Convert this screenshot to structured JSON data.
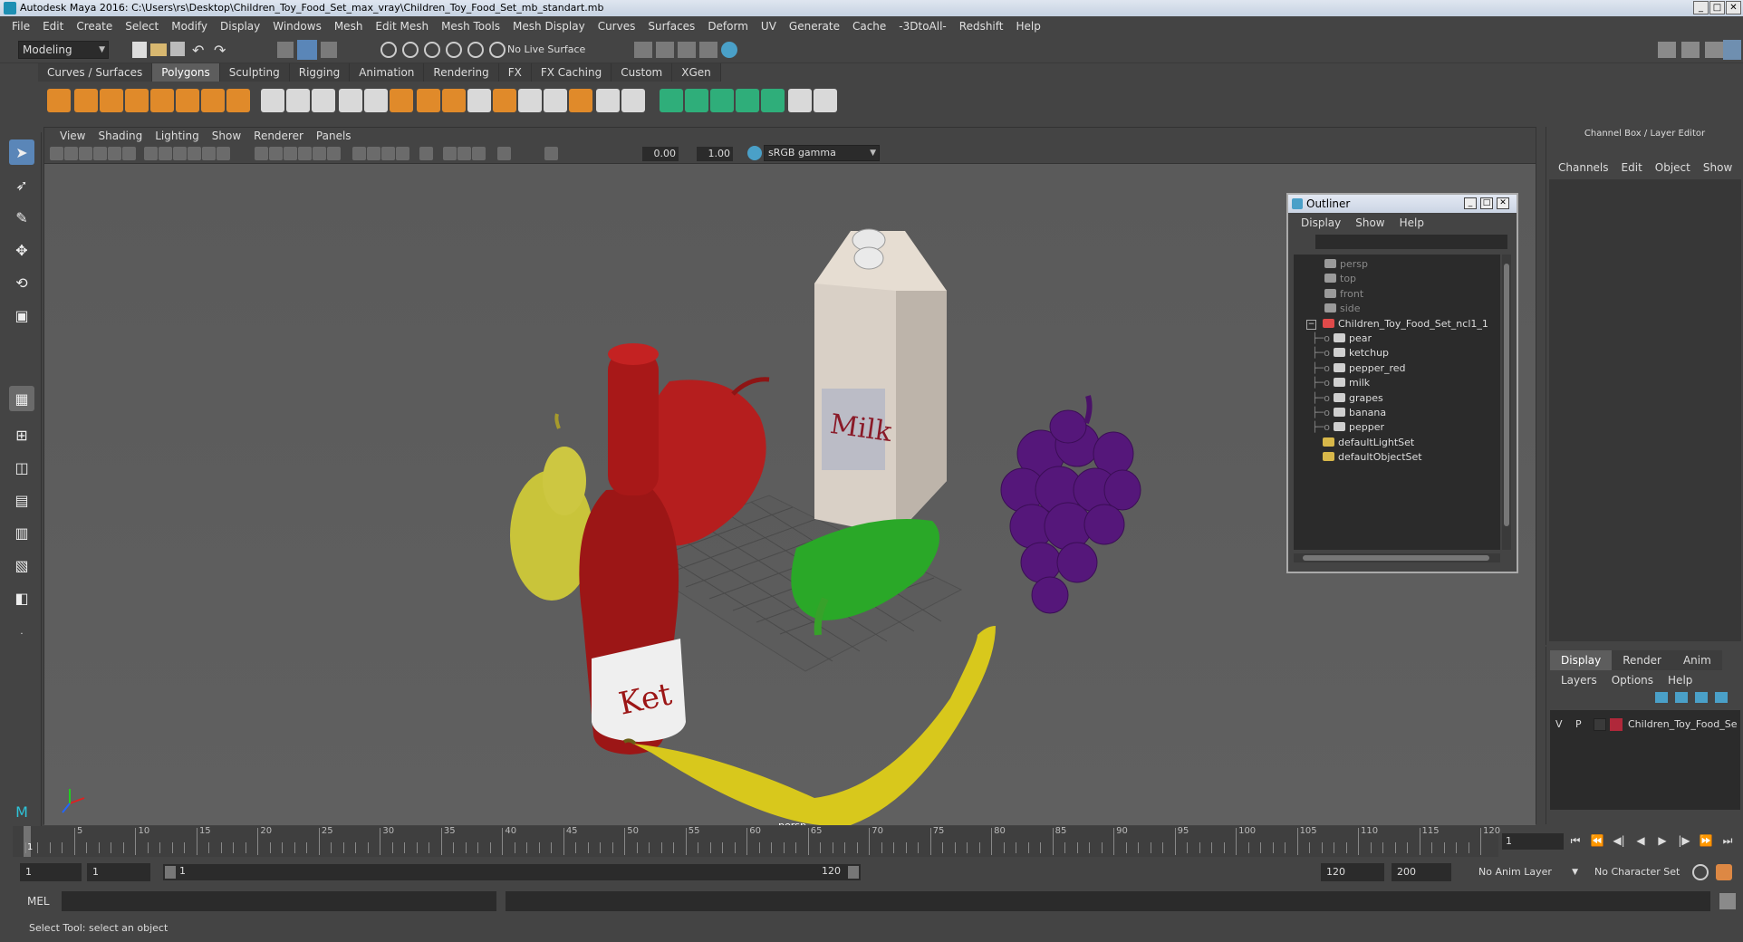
{
  "window": {
    "title": "Autodesk Maya 2016: C:\\Users\\rs\\Desktop\\Children_Toy_Food_Set_max_vray\\Children_Toy_Food_Set_mb_standart.mb"
  },
  "menubar": [
    "File",
    "Edit",
    "Create",
    "Select",
    "Modify",
    "Display",
    "Windows",
    "Mesh",
    "Edit Mesh",
    "Mesh Tools",
    "Mesh Display",
    "Curves",
    "Surfaces",
    "Deform",
    "UV",
    "Generate",
    "Cache",
    "-3DtoAll-",
    "Redshift",
    "Help"
  ],
  "statusline": {
    "mode": "Modeling",
    "live_surface": "No Live Surface"
  },
  "shelf": {
    "tabs": [
      "Curves / Surfaces",
      "Polygons",
      "Sculpting",
      "Rigging",
      "Animation",
      "Rendering",
      "FX",
      "FX Caching",
      "Custom",
      "XGen"
    ],
    "active_tab": "Polygons"
  },
  "viewport": {
    "menu": [
      "View",
      "Shading",
      "Lighting",
      "Show",
      "Renderer",
      "Panels"
    ],
    "exposure": "0.00",
    "gamma": "1.00",
    "colorspace": "sRGB gamma",
    "camera": "persp"
  },
  "outliner": {
    "title": "Outliner",
    "menu": [
      "Display",
      "Show",
      "Help"
    ],
    "cameras": [
      "persp",
      "top",
      "front",
      "side"
    ],
    "group": "Children_Toy_Food_Set_ncl1_1",
    "children": [
      "pear",
      "ketchup",
      "pepper_red",
      "milk",
      "grapes",
      "banana",
      "pepper"
    ],
    "sets": [
      "defaultLightSet",
      "defaultObjectSet"
    ]
  },
  "channelbox": {
    "title": "Channel Box / Layer Editor",
    "menu": [
      "Channels",
      "Edit",
      "Object",
      "Show"
    ]
  },
  "layereditor": {
    "tabs": [
      "Display",
      "Render",
      "Anim"
    ],
    "active_tab": "Display",
    "menu": [
      "Layers",
      "Options",
      "Help"
    ],
    "layer": {
      "v": "V",
      "p": "P",
      "name": "Children_Toy_Food_Se",
      "color": "#b0283a"
    }
  },
  "timeline": {
    "ticks": [
      "5",
      "10",
      "15",
      "20",
      "25",
      "30",
      "35",
      "40",
      "45",
      "50",
      "55",
      "60",
      "65",
      "70",
      "75",
      "80",
      "85",
      "90",
      "95",
      "100",
      "105",
      "110",
      "115",
      "120"
    ],
    "start_marker": "1",
    "current_frame": "1"
  },
  "range": {
    "start": "1",
    "playback_start": "1",
    "slider_start": "1",
    "slider_end": "120",
    "playback_end": "120",
    "end": "200",
    "anim_layer": "No Anim Layer",
    "character_set": "No Character Set"
  },
  "cmdline": {
    "label": "MEL"
  },
  "helpline": {
    "text": "Select Tool: select an object"
  },
  "scene_labels": {
    "milk": "Milk",
    "ketchup": "Ket"
  },
  "colors": {
    "accent": "#5d5d5d",
    "outliner_title": "#cbd5e4",
    "layer_color": "#b0283a"
  }
}
